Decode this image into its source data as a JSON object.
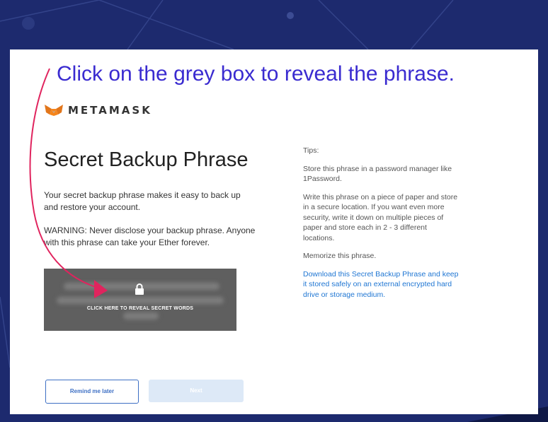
{
  "instruction": "Click on the grey box to reveal the phrase.",
  "brand": {
    "name": "METAMASK"
  },
  "page": {
    "title": "Secret Backup Phrase",
    "description": "Your secret backup phrase makes it easy to back up and restore your account.",
    "warning": "WARNING: Never disclose your backup phrase. Anyone with this phrase can take your Ether forever."
  },
  "reveal": {
    "label": "CLICK HERE TO REVEAL SECRET WORDS"
  },
  "tips": {
    "heading": "Tips:",
    "items": [
      "Store this phrase in a password manager like 1Password.",
      "Write this phrase on a piece of paper and store in a secure location. If you want even more security, write it down on multiple pieces of paper and store each in 2 - 3 different locations.",
      "Memorize this phrase."
    ],
    "download_link": "Download this Secret Backup Phrase and keep it stored safely on an external encrypted hard drive or storage medium."
  },
  "buttons": {
    "remind": "Remind me later",
    "next": "Next"
  },
  "colors": {
    "background": "#1d2a6e",
    "instruction": "#3a2bd0",
    "arrow": "#e0245e",
    "link": "#1f76d3",
    "reveal_box": "#5f5f5f"
  }
}
